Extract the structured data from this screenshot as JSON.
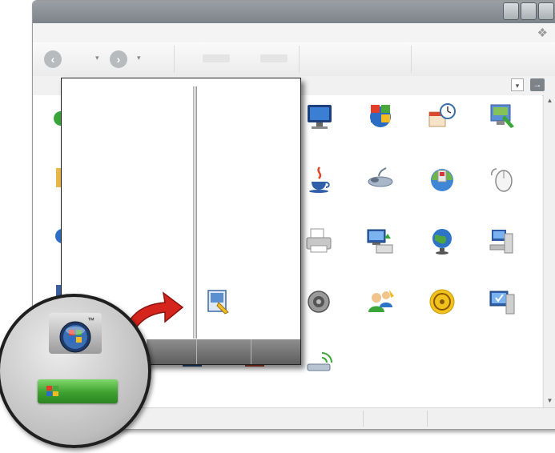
{
  "screen": {
    "background": "#ffffff"
  },
  "window": {
    "title_bar_color": "#8a9094",
    "controls": [
      "minimize-button",
      "maximize-button",
      "close-button"
    ],
    "toolbar": {
      "back_icon": "back-arrow-icon",
      "forward_icon": "forward-arrow-icon"
    },
    "address_bar": {
      "dropdown_glyph": "▾",
      "go_glyph": "→"
    }
  },
  "control_panel_icons": [
    {
      "name": "display-monitor-icon"
    },
    {
      "name": "windows-logo-icon"
    },
    {
      "name": "date-time-icon"
    },
    {
      "name": "desktop-customize-icon"
    },
    {
      "name": "java-icon"
    },
    {
      "name": "game-controller-icon"
    },
    {
      "name": "security-center-icon"
    },
    {
      "name": "mouse-icon"
    },
    {
      "name": "printer-icon"
    },
    {
      "name": "network-connections-icon"
    },
    {
      "name": "internet-options-icon"
    },
    {
      "name": "computer-tower-icon"
    },
    {
      "name": "speaker-icon"
    },
    {
      "name": "user-accounts-icon"
    },
    {
      "name": "wireless-icon"
    },
    {
      "name": "system-icon"
    },
    {
      "name": "wireless-network-icon"
    }
  ],
  "start_menu": {
    "right_pane_icon": "control-panel-icon",
    "bottom_bar_color": "#707070"
  },
  "callout": {
    "badge_text": "™",
    "orb_icon": "windows-vista-orb-icon",
    "start_button_icon": "windows-xp-logo-icon",
    "start_button_color": "#3da12f",
    "arrow_color": "#d5241c"
  }
}
